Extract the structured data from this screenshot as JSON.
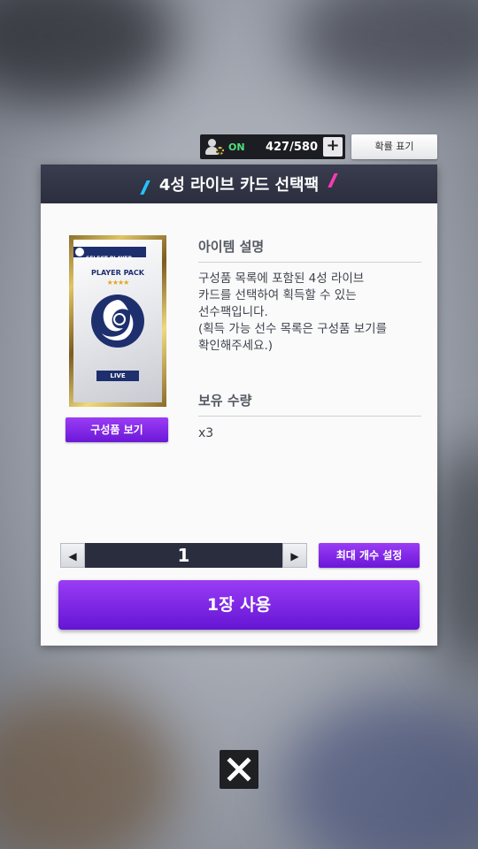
{
  "top_bar": {
    "status_on": "ON",
    "slot_count": "427/580",
    "plus_label": "+",
    "probability_label": "확률 표기"
  },
  "dialog": {
    "title": "4성 라이브 카드 선택팩",
    "card": {
      "top_label": "SELECT PLAYER",
      "pack_label": "PLAYER PACK",
      "stars": "★★★★",
      "live_label": "LIVE"
    },
    "components_button": "구성품 보기",
    "item_description_heading": "아이템 설명",
    "description_lines": [
      "구성품 목록에 포함된 4성 라이브",
      "카드를 선택하여 획득할 수 있는",
      "선수팩입니다.",
      "(획득 가능 선수 목록은 구성품 보기를",
      "확인해주세요.)"
    ],
    "owned_heading": "보유 수량",
    "owned_value": "x3",
    "quantity": "1",
    "decrement_label": "◀",
    "increment_label": "▶",
    "max_button": "최대 개수 설정",
    "use_button": "1장 사용"
  },
  "colors": {
    "accent_purple": "#7a22e6",
    "header_dark": "#2b2e3e",
    "status_green": "#4fe07a"
  },
  "icons": {
    "close": "close-icon",
    "user_status": "user-gear-icon"
  }
}
